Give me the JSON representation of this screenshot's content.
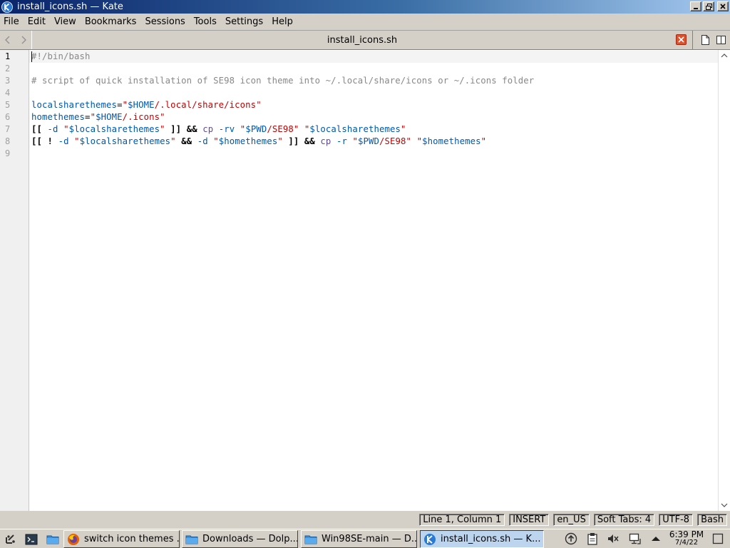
{
  "window": {
    "title": "install_icons.sh — Kate"
  },
  "menu": [
    {
      "label": "File"
    },
    {
      "label": "Edit"
    },
    {
      "label": "View"
    },
    {
      "label": "Bookmarks"
    },
    {
      "label": "Sessions"
    },
    {
      "label": "Tools"
    },
    {
      "label": "Settings"
    },
    {
      "label": "Help"
    }
  ],
  "tab": {
    "title": "install_icons.sh"
  },
  "editor": {
    "current_line": 1,
    "line_numbers": [
      "1",
      "2",
      "3",
      "4",
      "5",
      "6",
      "7",
      "8",
      "9"
    ],
    "lines": [
      "#!/bin/bash",
      "",
      "# script of quick installation of SE98 icon theme into ~/.local/share/icons or ~/.icons folder",
      "",
      "localsharethemes=\"$HOME/.local/share/icons\"",
      "homethemes=\"$HOME/.icons\"",
      "[[ -d \"$localsharethemes\" ]] && cp -rv \"$PWD/SE98\" \"$localsharethemes\"",
      "[[ ! -d \"$localsharethemes\" && -d \"$homethemes\" ]] && cp -r \"$PWD/SE98\" \"$homethemes\"",
      ""
    ]
  },
  "status": {
    "position": "Line 1, Column 1",
    "mode": "INSERT",
    "language": "en_US",
    "indent": "Soft Tabs: 4",
    "encoding": "UTF-8",
    "syntax": "Bash"
  },
  "taskbar": {
    "tasks": [
      {
        "label": "switch icon themes ...",
        "icon": "firefox-icon"
      },
      {
        "label": "Downloads — Dolp...",
        "icon": "folder-icon"
      },
      {
        "label": "Win98SE-main — D...",
        "icon": "folder-icon"
      },
      {
        "label": "install_icons.sh — K...",
        "icon": "kate-icon"
      }
    ],
    "clock": {
      "time": "6:39 PM",
      "date": "7/4/22"
    }
  },
  "colors": {
    "titlebar_start": "#0a246a",
    "titlebar_end": "#a6caf0",
    "comment": "#898887",
    "variable": "#0057ae",
    "string": "#bf0303",
    "active_task": "#bcd4ee"
  }
}
